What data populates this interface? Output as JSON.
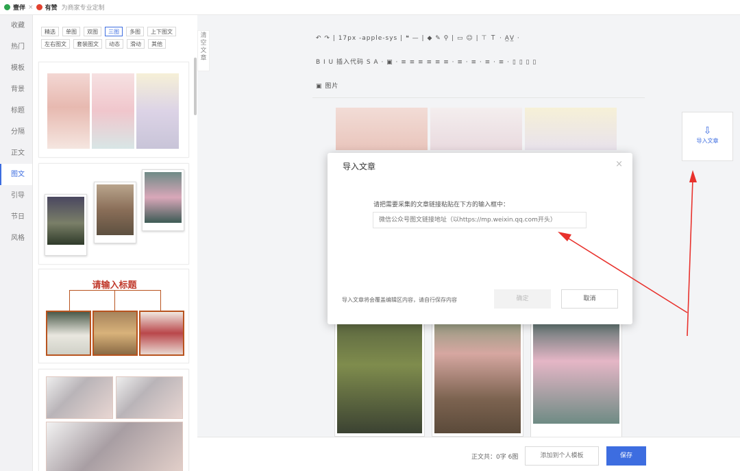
{
  "brand": {
    "name1": "壹伴",
    "sep": "×",
    "name2": "有赞",
    "slogan": "为商家专业定制",
    "color1": "#2da44e",
    "color2": "#e2412f"
  },
  "leftnav": {
    "items": [
      "收藏",
      "热门",
      "模板",
      "背景",
      "标题",
      "分隔",
      "正文",
      "图文",
      "引导",
      "节日",
      "风格"
    ],
    "active_index": 7
  },
  "tabs": [
    {
      "label": "精选",
      "active": false
    },
    {
      "label": "单图",
      "active": false
    },
    {
      "label": "双图",
      "active": false
    },
    {
      "label": "三图",
      "active": true
    },
    {
      "label": "多图",
      "active": false
    },
    {
      "label": "上下图文",
      "active": false
    },
    {
      "label": "左右图文",
      "active": false
    },
    {
      "label": "套装图文",
      "active": false
    },
    {
      "label": "动态",
      "active": false
    },
    {
      "label": "滑动",
      "active": false
    },
    {
      "label": "其他",
      "active": false
    }
  ],
  "clear_col": {
    "label": "清空文章"
  },
  "template_title": "请输入标题",
  "toolbar": {
    "row1": "↶ ↷ | 17px -apple-sys | ❝ — | ◆ ✎ ⚲ | ▭ ☺ | ⊤ Ｔ · A̲V̲ ·",
    "row2": "B  I  U  插入代码  S  A ·  ▣ ·  ≡  ≡  ≡  ≡  ≡  ≡ ·  ≡ ·  ≡ ·  ≡ ·  ≡ ·  ▯  ▯  ▯  ▯",
    "row3": "▣ 图片"
  },
  "right": {
    "import_icon": "⇩",
    "import_label": "导入文章"
  },
  "bottom": {
    "count": "正文共：0字 6图",
    "add_template": "添加到个人模板",
    "save": "保存"
  },
  "modal": {
    "title": "导入文章",
    "close": "×",
    "instruction": "请把需要采集的文章链接粘贴在下方的输入框中：",
    "placeholder": "微信公众号图文链接地址（以https://mp.weixin.qq.com开头）",
    "note": "导入文章将会覆盖编辑区内容，请自行保存内容",
    "ok": "确定",
    "cancel": "取消"
  },
  "colors": {
    "accent": "#3d6de0",
    "annotation": "#e8312c"
  }
}
